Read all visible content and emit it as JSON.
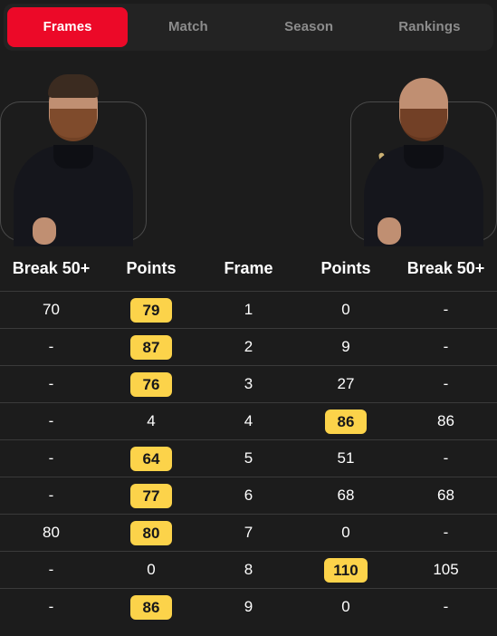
{
  "tabs": [
    {
      "label": "Frames",
      "active": true
    },
    {
      "label": "Match",
      "active": false
    },
    {
      "label": "Season",
      "active": false
    },
    {
      "label": "Rankings",
      "active": false
    }
  ],
  "players": {
    "left": {
      "photo": "player-photo-left"
    },
    "right": {
      "photo": "player-photo-right"
    }
  },
  "colors": {
    "accent_red": "#ec0928",
    "highlight_yellow": "#fcd34a",
    "background": "#1c1c1c",
    "tabbar_background": "#232323",
    "row_divider": "#3a3a3a",
    "inactive_tab_text": "#8c8c8c"
  },
  "table": {
    "headers": [
      "Break 50+",
      "Points",
      "Frame",
      "Points",
      "Break 50+"
    ],
    "rows": [
      {
        "break_left": "70",
        "points_left": "79",
        "points_left_highlight": true,
        "frame": "1",
        "points_right": "0",
        "points_right_highlight": false,
        "break_right": "-"
      },
      {
        "break_left": "-",
        "points_left": "87",
        "points_left_highlight": true,
        "frame": "2",
        "points_right": "9",
        "points_right_highlight": false,
        "break_right": "-"
      },
      {
        "break_left": "-",
        "points_left": "76",
        "points_left_highlight": true,
        "frame": "3",
        "points_right": "27",
        "points_right_highlight": false,
        "break_right": "-"
      },
      {
        "break_left": "-",
        "points_left": "4",
        "points_left_highlight": false,
        "frame": "4",
        "points_right": "86",
        "points_right_highlight": true,
        "break_right": "86"
      },
      {
        "break_left": "-",
        "points_left": "64",
        "points_left_highlight": true,
        "frame": "5",
        "points_right": "51",
        "points_right_highlight": false,
        "break_right": "-"
      },
      {
        "break_left": "-",
        "points_left": "77",
        "points_left_highlight": true,
        "frame": "6",
        "points_right": "68",
        "points_right_highlight": false,
        "break_right": "68"
      },
      {
        "break_left": "80",
        "points_left": "80",
        "points_left_highlight": true,
        "frame": "7",
        "points_right": "0",
        "points_right_highlight": false,
        "break_right": "-"
      },
      {
        "break_left": "-",
        "points_left": "0",
        "points_left_highlight": false,
        "frame": "8",
        "points_right": "110",
        "points_right_highlight": true,
        "break_right": "105"
      },
      {
        "break_left": "-",
        "points_left": "86",
        "points_left_highlight": true,
        "frame": "9",
        "points_right": "0",
        "points_right_highlight": false,
        "break_right": "-"
      }
    ]
  }
}
